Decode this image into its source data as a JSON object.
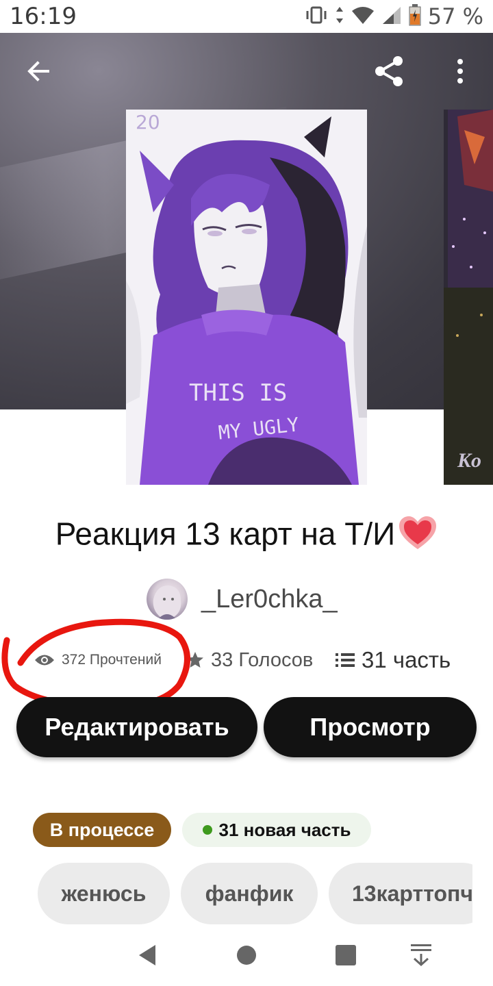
{
  "status_bar": {
    "time": "16:19",
    "battery": "57 %",
    "icons": [
      "vibrate-icon",
      "data-arrows-icon",
      "wifi-icon",
      "signal-icon",
      "battery-icon"
    ]
  },
  "toolbar": {
    "back_icon": "arrow-left-icon",
    "share_icon": "share-icon",
    "more_icon": "more-vertical-icon"
  },
  "cover": {
    "text_line_1": "THIS IS",
    "text_line_2": "MY UGLY",
    "corner_text": "20",
    "side_cover_text": "Ko"
  },
  "story": {
    "title": "Реакция 13 карт на Т/И",
    "title_emoji": "heart-icon",
    "author": "_Ler0chka_"
  },
  "stats": {
    "reads": "372 Прочтений",
    "votes": "33 Голосов",
    "parts": "31 часть"
  },
  "actions": {
    "edit": "Редактировать",
    "view": "Просмотр"
  },
  "badges": {
    "status": "В процессе",
    "new_parts": "31 новая часть",
    "status_color": "#8a5a1a",
    "new_dot_color": "#3e9a1e"
  },
  "tags": [
    "женюсь",
    "фанфик",
    "13карттопч"
  ],
  "nav": {
    "back": "triangle-back-icon",
    "home": "circle-home-icon",
    "recents": "square-recents-icon",
    "extra": "download-arrow-icon"
  },
  "colors": {
    "primary": "#121212",
    "annotation": "#e8170f"
  }
}
